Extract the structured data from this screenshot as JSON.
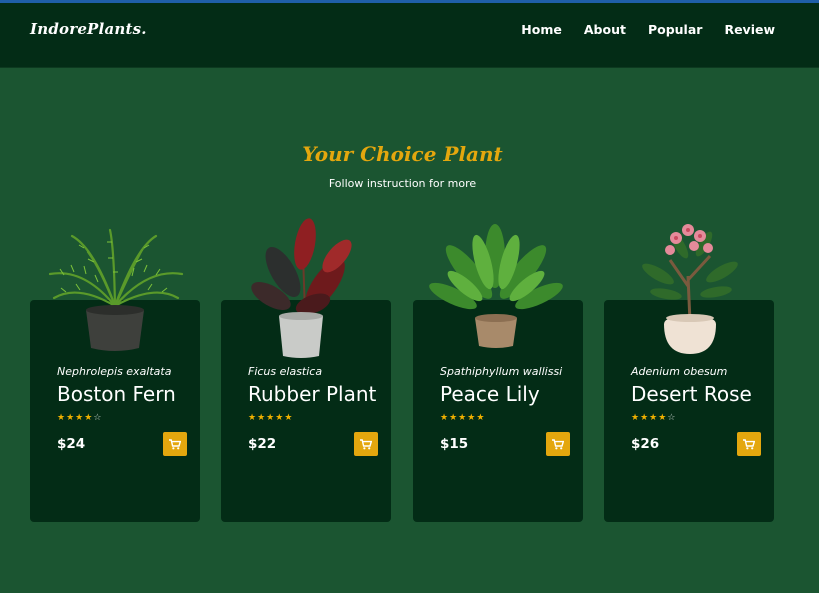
{
  "brand": {
    "logo": "IndorePlants."
  },
  "nav": {
    "items": [
      "Home",
      "About",
      "Popular",
      "Review"
    ]
  },
  "section": {
    "title": "Your Choice Plant",
    "subtitle": "Follow instruction for more"
  },
  "products": [
    {
      "scientific": "Nephrolepis exaltata",
      "name": "Boston Fern",
      "price": "$24",
      "rating": 3.5,
      "stars_max": 5
    },
    {
      "scientific": "Ficus elastica",
      "name": "Rubber Plant",
      "price": "$22",
      "rating": 5,
      "stars_max": 5
    },
    {
      "scientific": "Spathiphyllum wallissi",
      "name": "Peace Lily",
      "price": "$15",
      "rating": 4.5,
      "stars_max": 5
    },
    {
      "scientific": "Adenium obesum",
      "name": "Desert Rose",
      "price": "$26",
      "rating": 3.5,
      "stars_max": 5
    }
  ],
  "colors": {
    "background": "#1b5531",
    "header": "#032c16",
    "card": "#032c16",
    "accent": "#e4a70e",
    "star": "#f0b000"
  },
  "icons": {
    "cart": "cart-icon",
    "star": "star-icon"
  }
}
